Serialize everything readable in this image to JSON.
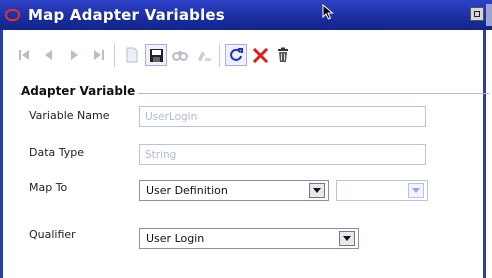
{
  "window": {
    "title": "Map Adapter Variables"
  },
  "toolbar": {
    "buttons": [
      {
        "icon": "first-record-icon",
        "enabled": false
      },
      {
        "icon": "previous-record-icon",
        "enabled": false
      },
      {
        "icon": "next-record-icon",
        "enabled": false
      },
      {
        "icon": "last-record-icon",
        "enabled": false
      },
      {
        "icon": "new-document-icon",
        "enabled": false
      },
      {
        "icon": "save-icon",
        "enabled": true
      },
      {
        "icon": "find-icon",
        "enabled": false
      },
      {
        "icon": "clear-icon",
        "enabled": false
      },
      {
        "icon": "refresh-icon",
        "enabled": true
      },
      {
        "icon": "cancel-icon",
        "enabled": true
      },
      {
        "icon": "delete-icon",
        "enabled": true
      }
    ],
    "accent": "#1f33b5",
    "cancel_color": "#e21b1b"
  },
  "form": {
    "group_title": "Adapter Variable",
    "variable_name_label": "Variable Name",
    "variable_name_value": "UserLogin",
    "data_type_label": "Data Type",
    "data_type_value": "String",
    "map_to_label": "Map To",
    "map_to_value": "User Definition",
    "map_to_secondary_value": "",
    "qualifier_label": "Qualifier",
    "qualifier_value": "User Login"
  }
}
